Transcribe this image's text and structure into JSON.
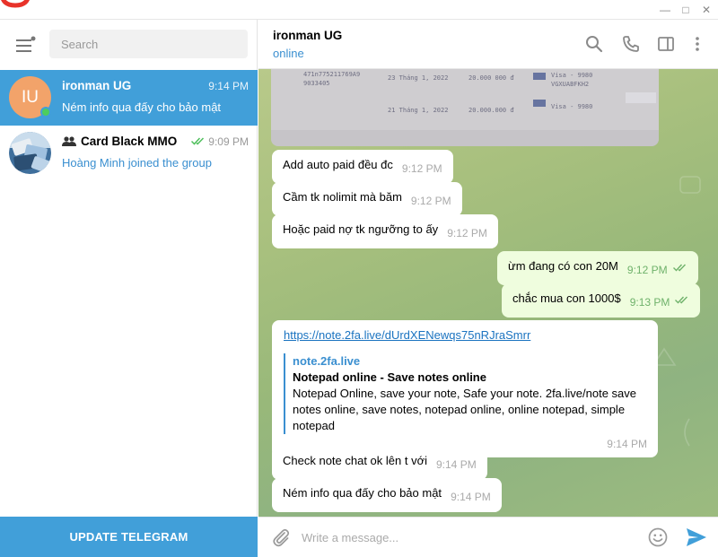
{
  "window": {
    "minimize_glyph": "—",
    "maximize_glyph": "□",
    "close_glyph": "✕"
  },
  "sidebar": {
    "search_placeholder": "Search",
    "chats": [
      {
        "avatar_initials": "IU",
        "name": "ironman UG",
        "time": "9:14 PM",
        "preview": "Ném info qua đấy cho bảo mật",
        "online": true
      },
      {
        "name": "Card Black MMO",
        "time": "9:09 PM",
        "preview": "Hoàng Minh joined the group",
        "is_group": true
      }
    ],
    "update_label": "UPDATE TELEGRAM"
  },
  "chat": {
    "peer_name": "ironman UG",
    "peer_status": "online",
    "photo_rows": [
      {
        "a": "471n775211769A9",
        "b": "23 Tháng 1, 2022",
        "c": "20.000 000 đ",
        "d": "Visa - 9980"
      },
      {
        "a": "9033405",
        "b": "",
        "c": "",
        "d": "VGXUABFKH2"
      },
      {
        "a": "",
        "b": "21 Tháng 1, 2022",
        "c": "20.000.000 đ",
        "d": "Visa - 9980"
      }
    ],
    "messages": [
      {
        "text": "Add auto paid đều đc",
        "time": "9:12 PM",
        "out": false
      },
      {
        "text": "Cầm tk nolimit mà băm",
        "time": "9:12 PM",
        "out": false
      },
      {
        "text": "Hoặc paid nợ tk ngưỡng to ấy",
        "time": "9:12 PM",
        "out": false
      },
      {
        "text": "ừm đang có con 20M",
        "time": "9:12 PM",
        "out": true
      },
      {
        "text": "chắc mua con 1000$",
        "time": "9:13 PM",
        "out": true
      },
      {
        "text": "Check note chat ok lên t với",
        "time": "9:14 PM",
        "out": false
      },
      {
        "text": "Ném info qua đấy cho bảo mật",
        "time": "9:14 PM",
        "out": false
      }
    ],
    "link_message": {
      "url": "https://note.2fa.live/dUrdXENewqs75nRJraSmrr",
      "site": "note.2fa.live",
      "title": "Notepad online - Save notes online",
      "description": "Notepad Online, save your note, Safe your note. 2fa.live/note save notes online, save notes, notepad online, online notepad, simple notepad",
      "time": "9:14 PM"
    },
    "composer_placeholder": "Write a message..."
  },
  "colors": {
    "accent": "#419fd9",
    "outgoing_bubble": "#effdde",
    "online": "#4dcd5e",
    "link": "#3a8fd0",
    "check": "#6fb26b"
  }
}
